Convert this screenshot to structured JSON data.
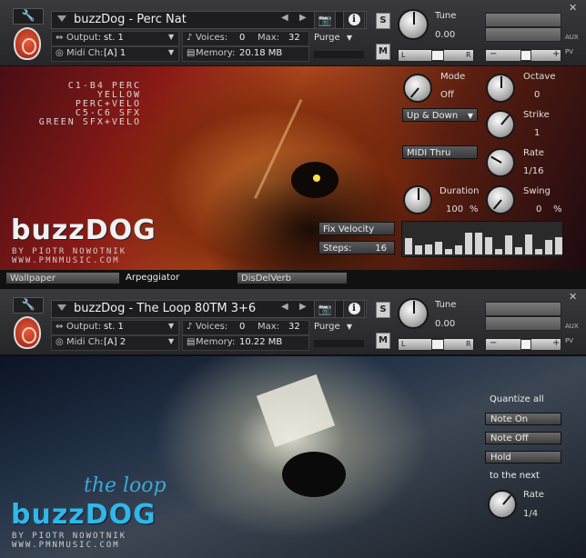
{
  "instrument1": {
    "title": "buzzDog - Perc Nat",
    "output_label": "Output:",
    "output_value": "st. 1",
    "voices_label": "Voices:",
    "voices_value": "0",
    "max_label": "Max:",
    "max_value": "32",
    "purge_label": "Purge",
    "midi_label": "Midi Ch:",
    "midi_value": "[A]  1",
    "memory_label": "Memory:",
    "memory_value": "20.18 MB",
    "tune_label": "Tune",
    "tune_value": "0.00",
    "s_label": "S",
    "m_label": "M",
    "aux_label": "AUX",
    "pv_label": "PV",
    "l_label": "L",
    "r_label": "R",
    "minus_label": "−",
    "plus_label": "+"
  },
  "instrument2": {
    "title": "buzzDog - The Loop 80TM 3+6",
    "output_label": "Output:",
    "output_value": "st. 1",
    "voices_label": "Voices:",
    "voices_value": "0",
    "max_label": "Max:",
    "max_value": "32",
    "purge_label": "Purge",
    "midi_label": "Midi Ch:",
    "midi_value": "[A]  2",
    "memory_label": "Memory:",
    "memory_value": "10.22 MB",
    "tune_label": "Tune",
    "tune_value": "0.00",
    "s_label": "S",
    "m_label": "M",
    "aux_label": "AUX",
    "pv_label": "PV",
    "l_label": "L",
    "r_label": "R",
    "minus_label": "−",
    "plus_label": "+"
  },
  "panel1": {
    "legend": [
      "C1-B4 PERC",
      "YELLOW PERC+VELO",
      "C5-C6 SFX",
      "GREEN SFX+VELO"
    ],
    "brand": "buzzDOG",
    "byline1": "BY PIOTR NOWOTNIK",
    "byline2": "WWW.PMNMUSIC.COM",
    "mode_label": "Mode",
    "mode_value": "Off",
    "octave_label": "Octave",
    "octave_value": "0",
    "direction_value": "Up & Down",
    "strike_label": "Strike",
    "strike_value": "1",
    "midi_thru": "MIDI Thru",
    "rate_label": "Rate",
    "rate_value": "1/16",
    "duration_label": "Duration",
    "duration_value": "100",
    "duration_unit": "%",
    "swing_label": "Swing",
    "swing_value": "0",
    "swing_unit": "%",
    "fix_velocity": "Fix Velocity",
    "steps_label": "Steps:",
    "steps_value": "16",
    "step_levels": [
      0.55,
      0.3,
      0.35,
      0.45,
      0.2,
      0.3,
      0.75,
      0.75,
      0.6,
      0.2,
      0.65,
      0.25,
      0.7,
      0.2,
      0.5,
      0.6
    ]
  },
  "tabs": [
    "Wallpaper",
    "Arpeggiator",
    "DisDelVerb"
  ],
  "panel2": {
    "brand_top": "the loop",
    "brand": "buzzDOG",
    "byline1": "BY PIOTR NOWOTNIK",
    "byline2": "WWW.PMNMUSIC.COM",
    "quantize_all": "Quantize all",
    "note_on": "Note On",
    "note_off": "Note Off",
    "hold": "Hold",
    "to_next": "to the next",
    "rate_label": "Rate",
    "rate_value": "1/4"
  }
}
